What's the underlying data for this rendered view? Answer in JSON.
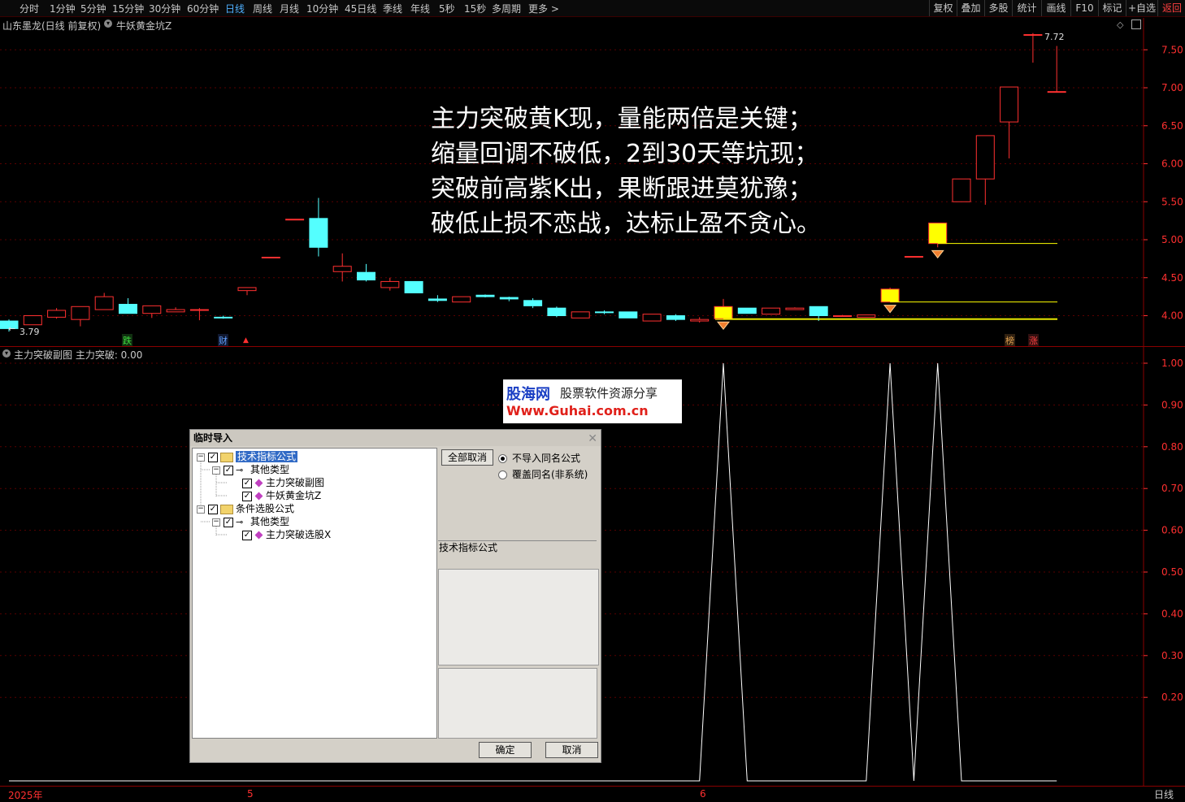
{
  "toolbar": {
    "periods": [
      "分时",
      "1分钟",
      "5分钟",
      "15分钟",
      "30分钟",
      "60分钟",
      "日线",
      "周线",
      "月线",
      "10分钟",
      "45日线",
      "季线",
      "年线",
      "5秒",
      "15秒",
      "多周期",
      "更多 >"
    ],
    "active_period": "日线",
    "right_buttons": [
      "复权",
      "叠加",
      "多股",
      "统计",
      "画线",
      "F10",
      "标记",
      "+自选",
      "返回"
    ]
  },
  "main_pane": {
    "stock_title": "山东墨龙(日线 前复权)",
    "indicator_title": "牛妖黄金坑Z",
    "high_label": "7.72",
    "low_label": "3.79",
    "markers": [
      "跌",
      "财",
      "榜",
      "涨"
    ],
    "poem": [
      "主力突破黄K现，量能两倍是关键；",
      "缩量回调不破低，2到30天等坑现；",
      "突破前高紫K出，果断跟进莫犹豫；",
      "破低止损不恋战，达标止盈不贪心。"
    ]
  },
  "sub_pane": {
    "title": "主力突破副图  主力突破: 0.00"
  },
  "x_axis": {
    "year_label": "2025年",
    "month_labels": [
      "5",
      "6"
    ],
    "period_label": "日线"
  },
  "watermark": {
    "logo": "股海网",
    "slogan": "股票软件资源分享",
    "url": "Www.Guhai.com.cn"
  },
  "dialog": {
    "title": "临时导入",
    "tree": {
      "group1": "技术指标公式",
      "group1_sub": "其他类型",
      "group1_item1": "主力突破副图",
      "group1_item2": "牛妖黄金坑Z",
      "group2": "条件选股公式",
      "group2_sub": "其他类型",
      "group2_item1": "主力突破选股X"
    },
    "cancel_all_label": "全部取消",
    "radio_no_import": "不导入同名公式",
    "radio_overwrite": "覆盖同名(非系统)",
    "section_label": "技术指标公式",
    "ok_label": "确定",
    "cancel_label": "取消"
  },
  "colors": {
    "up_candle": "#ff3030",
    "down_candle": "#54ffff",
    "signal_candle": "#ffff00",
    "axis_red": "#ff3030",
    "grid": "#5a0000"
  },
  "chart_data": [
    {
      "type": "candlestick",
      "title": "山东墨龙(日线 前复权)",
      "ylim": [
        3.79,
        7.72
      ],
      "y_ticks": [
        4.0,
        4.5,
        5.0,
        5.5,
        6.0,
        6.5,
        7.0,
        7.5
      ],
      "candles": [
        {
          "o": 3.93,
          "c": 3.83,
          "h": 3.95,
          "l": 3.79
        },
        {
          "o": 3.88,
          "c": 4.0,
          "h": 4.0,
          "l": 3.88
        },
        {
          "o": 3.98,
          "c": 4.07,
          "h": 4.1,
          "l": 3.96
        },
        {
          "o": 3.95,
          "c": 4.12,
          "h": 4.12,
          "l": 3.86
        },
        {
          "o": 4.08,
          "c": 4.25,
          "h": 4.3,
          "l": 4.08
        },
        {
          "o": 4.15,
          "c": 4.03,
          "h": 4.23,
          "l": 4.03
        },
        {
          "o": 4.03,
          "c": 4.13,
          "h": 4.13,
          "l": 3.97
        },
        {
          "o": 4.05,
          "c": 4.08,
          "h": 4.11,
          "l": 4.05
        },
        {
          "o": 4.08,
          "c": 4.08,
          "h": 4.1,
          "l": 3.94
        },
        {
          "o": 3.98,
          "c": 3.97,
          "h": 4.0,
          "l": 3.96
        },
        {
          "o": 4.33,
          "c": 4.37,
          "h": 4.37,
          "l": 4.27
        },
        {
          "o": 4.77,
          "c": 4.77,
          "h": 4.77,
          "l": 4.77
        },
        {
          "o": 5.27,
          "c": 5.27,
          "h": 5.27,
          "l": 5.27
        },
        {
          "o": 5.28,
          "c": 4.9,
          "h": 5.55,
          "l": 4.78
        },
        {
          "o": 4.58,
          "c": 4.65,
          "h": 4.82,
          "l": 4.45
        },
        {
          "o": 4.57,
          "c": 4.47,
          "h": 4.68,
          "l": 4.45
        },
        {
          "o": 4.37,
          "c": 4.45,
          "h": 4.5,
          "l": 4.33
        },
        {
          "o": 4.45,
          "c": 4.3,
          "h": 4.45,
          "l": 4.3
        },
        {
          "o": 4.22,
          "c": 4.2,
          "h": 4.27,
          "l": 4.18
        },
        {
          "o": 4.18,
          "c": 4.25,
          "h": 4.25,
          "l": 4.18
        },
        {
          "o": 4.27,
          "c": 4.25,
          "h": 4.28,
          "l": 4.24
        },
        {
          "o": 4.24,
          "c": 4.22,
          "h": 4.25,
          "l": 4.19
        },
        {
          "o": 4.2,
          "c": 4.13,
          "h": 4.23,
          "l": 4.1
        },
        {
          "o": 4.1,
          "c": 4.0,
          "h": 4.12,
          "l": 3.98
        },
        {
          "o": 3.97,
          "c": 4.05,
          "h": 4.05,
          "l": 3.97
        },
        {
          "o": 4.05,
          "c": 4.04,
          "h": 4.07,
          "l": 4.02
        },
        {
          "o": 4.05,
          "c": 3.97,
          "h": 4.05,
          "l": 3.97
        },
        {
          "o": 3.93,
          "c": 4.02,
          "h": 4.02,
          "l": 3.93
        },
        {
          "o": 4.0,
          "c": 3.95,
          "h": 4.02,
          "l": 3.93
        },
        {
          "o": 3.93,
          "c": 3.95,
          "h": 3.98,
          "l": 3.91
        },
        {
          "o": 3.96,
          "c": 4.12,
          "h": 4.22,
          "l": 3.96
        },
        {
          "o": 4.1,
          "c": 4.03,
          "h": 4.1,
          "l": 4.03
        },
        {
          "o": 4.02,
          "c": 4.1,
          "h": 4.1,
          "l": 4.02
        },
        {
          "o": 4.08,
          "c": 4.1,
          "h": 4.11,
          "l": 4.08
        },
        {
          "o": 4.12,
          "c": 4.0,
          "h": 4.12,
          "l": 3.93
        },
        {
          "o": 3.99,
          "c": 4.0,
          "h": 4.01,
          "l": 3.99
        },
        {
          "o": 3.98,
          "c": 4.01,
          "h": 4.01,
          "l": 3.98
        },
        {
          "o": 4.18,
          "c": 4.35,
          "h": 4.37,
          "l": 4.18
        },
        {
          "o": 4.78,
          "c": 4.78,
          "h": 4.78,
          "l": 4.78
        },
        {
          "o": 4.95,
          "c": 5.22,
          "h": 5.22,
          "l": 4.9
        },
        {
          "o": 5.5,
          "c": 5.8,
          "h": 5.8,
          "l": 5.5
        },
        {
          "o": 5.8,
          "c": 6.37,
          "h": 6.37,
          "l": 5.46
        },
        {
          "o": 6.55,
          "c": 7.01,
          "h": 7.01,
          "l": 6.07
        },
        {
          "o": 7.7,
          "c": 7.7,
          "h": 7.72,
          "l": 7.33
        },
        {
          "o": 6.95,
          "c": 6.95,
          "h": 7.55,
          "l": 6.95
        }
      ],
      "signal_indices": [
        30,
        37,
        39
      ]
    },
    {
      "type": "line",
      "title": "主力突破副图",
      "ylim": [
        0,
        1.0
      ],
      "y_ticks": [
        0.2,
        0.3,
        0.4,
        0.5,
        0.6,
        0.7,
        0.8,
        0.9,
        1.0
      ],
      "values": [
        0,
        0,
        0,
        0,
        0,
        0,
        0,
        0,
        0,
        0,
        0,
        0,
        0,
        0,
        0,
        0,
        0,
        0,
        0,
        0,
        0,
        0,
        0,
        0,
        0,
        0,
        0,
        0,
        0,
        0,
        1,
        0,
        0,
        0,
        0,
        0,
        0,
        1,
        0,
        1,
        0,
        0,
        0,
        0,
        0
      ]
    }
  ]
}
